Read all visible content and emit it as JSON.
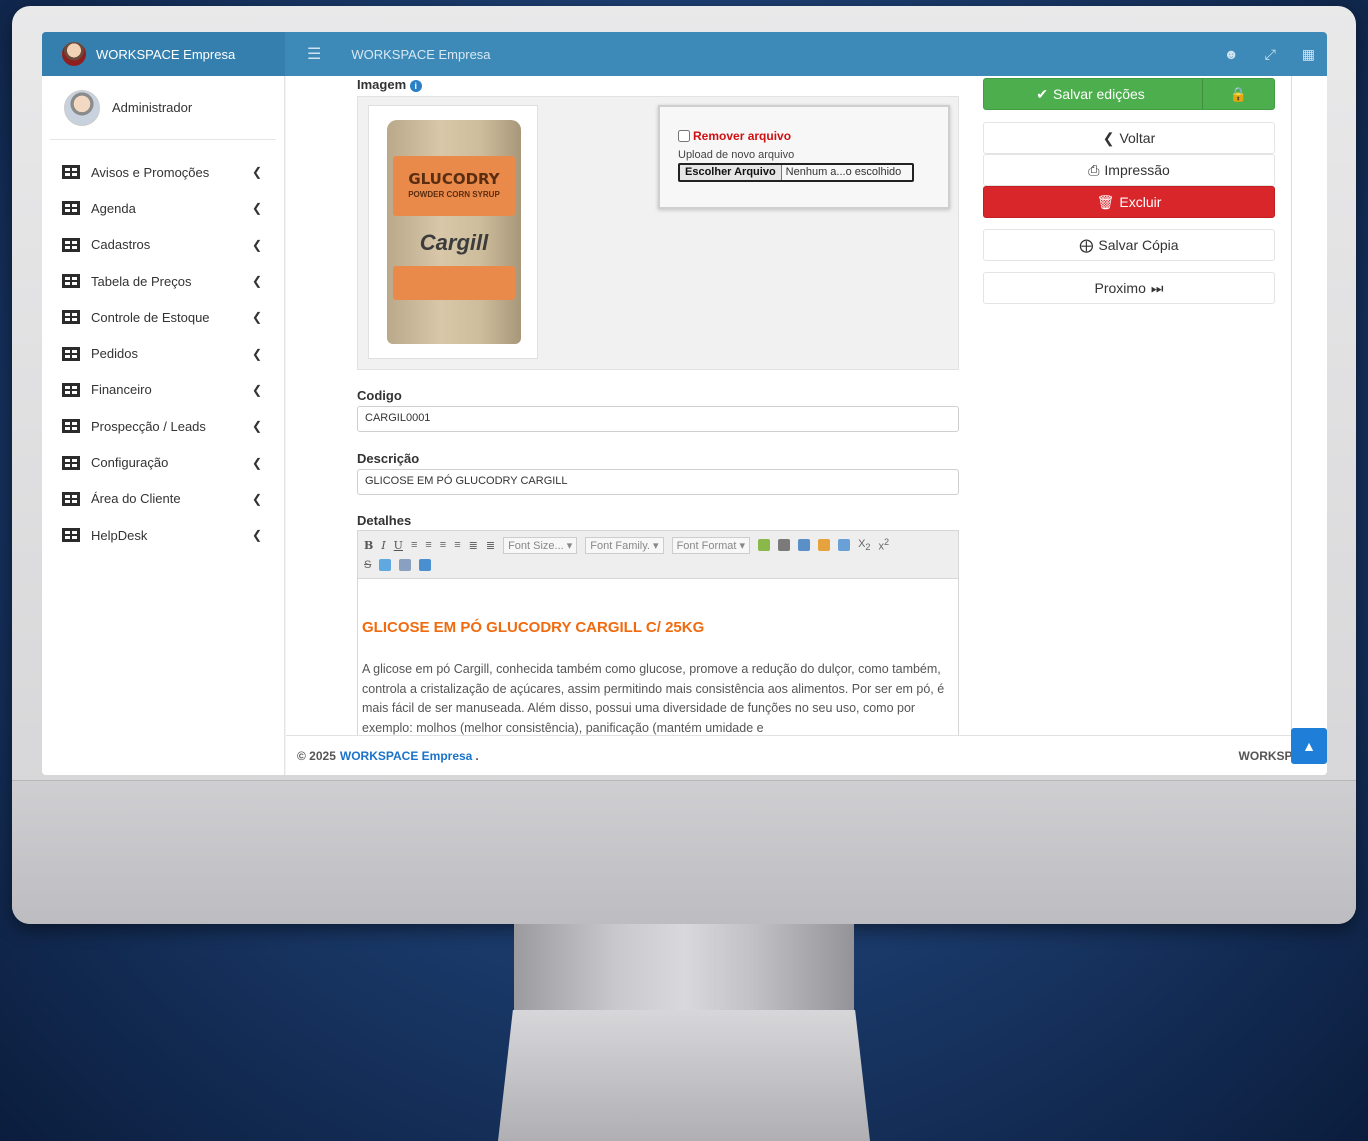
{
  "app": {
    "brand": "WORKSPACE Empresa",
    "top_title": "WORKSPACE Empresa"
  },
  "user": {
    "name": "Administrador"
  },
  "sidebar": {
    "items": [
      {
        "label": "Avisos e Promoções"
      },
      {
        "label": "Agenda"
      },
      {
        "label": "Cadastros"
      },
      {
        "label": "Tabela de Preços"
      },
      {
        "label": "Controle de Estoque"
      },
      {
        "label": "Pedidos"
      },
      {
        "label": "Financeiro"
      },
      {
        "label": "Prospecção / Leads"
      },
      {
        "label": "Configuração"
      },
      {
        "label": "Área do Cliente"
      },
      {
        "label": "HelpDesk"
      }
    ]
  },
  "image_section": {
    "label": "Imagem",
    "product_text": {
      "brand_line": "GLUCODRY",
      "sub_line": "POWDER CORN SYRUP",
      "maker": "Cargill"
    },
    "remove_label": "Remover arquivo",
    "upload_label": "Upload de novo arquivo",
    "choose_button": "Escolher Arquivo",
    "file_name": "Nenhum a...o escolhido"
  },
  "form": {
    "codigo_label": "Codigo",
    "codigo_value": "CARGIL0001",
    "descricao_label": "Descrição",
    "descricao_value": "GLICOSE EM PÓ GLUCODRY CARGILL",
    "detalhes_label": "Detalhes"
  },
  "editor": {
    "font_size": "Font Size...",
    "font_family": "Font Family.",
    "font_format": "Font Format",
    "title": "GLICOSE EM PÓ GLUCODRY CARGILL C/ 25KG",
    "body": "A glicose em pó Cargill, conhecida também como glucose, promove a redução do dulçor, como também, controla a cristalização de açúcares, assim permitindo mais consistência aos alimentos. Por ser em pó, é mais fácil de ser manuseada. Além disso, possui uma diversidade de funções no seu uso, como por exemplo: molhos (melhor consistência), panificação (mantém umidade e"
  },
  "actions": {
    "save": "Salvar edições",
    "back": "Voltar",
    "print": "Impressão",
    "delete": "Excluir",
    "save_copy": "Salvar Cópia",
    "next": "Proximo"
  },
  "footer": {
    "copyright": "© 2025",
    "link": "WORKSPACE Empresa",
    "dot": ".",
    "right": "WORKSPACE s"
  },
  "colors": {
    "topbar": "#3d8ab9",
    "save_green": "#4cae4c",
    "delete_red": "#d9262b",
    "title_orange": "#f06b0f",
    "link_blue": "#1a73c9"
  }
}
